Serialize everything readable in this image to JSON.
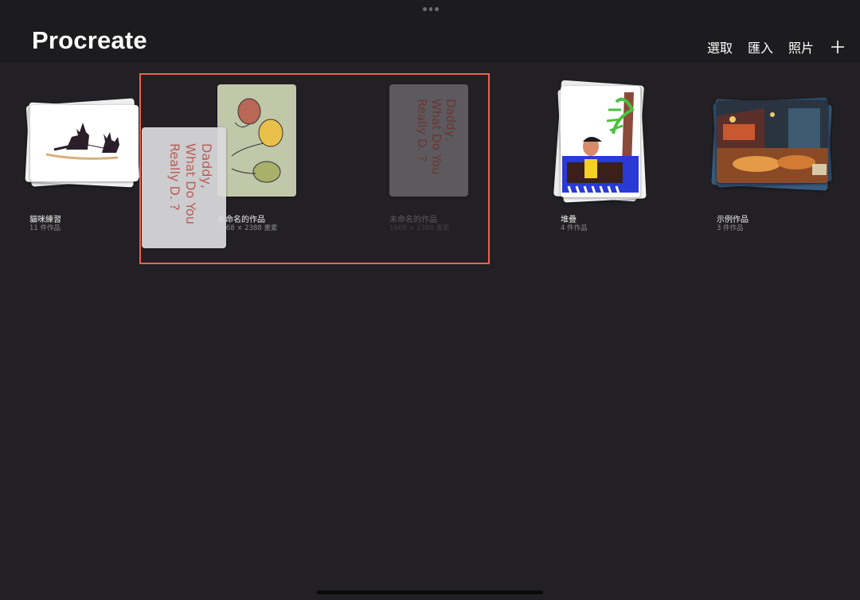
{
  "app": {
    "title": "Procreate"
  },
  "toolbar": {
    "select_label": "選取",
    "import_label": "匯入",
    "photo_label": "照片",
    "add_icon": "plus-icon"
  },
  "gallery": [
    {
      "title": "貓咪練習",
      "subtitle": "11 件作品"
    },
    {
      "title": "未命名的作品",
      "subtitle": "1668 × 2388 畫素"
    },
    {
      "title": "未命名的作品",
      "subtitle": "1668 × 2388 畫素"
    },
    {
      "title": "堆疊",
      "subtitle": "4 件作品"
    },
    {
      "title": "示例作品",
      "subtitle": "3 件作品"
    }
  ],
  "dragged_artwork": {
    "text": "Daddy, What Do You Really D. ?"
  },
  "colors": {
    "background": "#222024",
    "header": "#1c1b1d",
    "selection": "#e8624f"
  }
}
